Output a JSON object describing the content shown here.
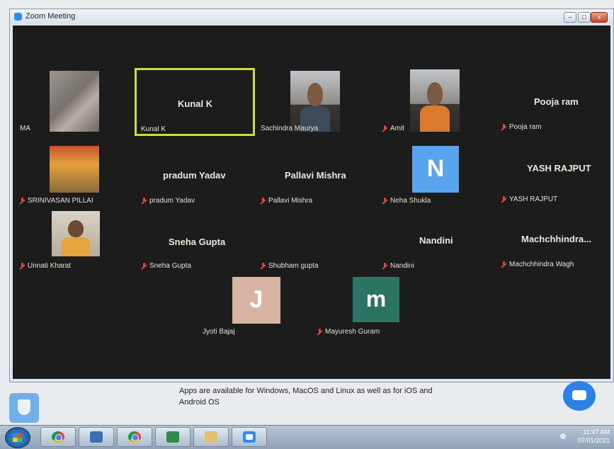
{
  "window": {
    "title": "Zoom Meeting",
    "buttons": {
      "minimize": "–",
      "maximize": "□",
      "close": "x"
    }
  },
  "participants": [
    {
      "name": "MA",
      "big_name": "",
      "muted": false,
      "kind": "video",
      "icon": "video-wall"
    },
    {
      "name": "Kunal K",
      "big_name": "Kunal K",
      "muted": false,
      "kind": "name",
      "active_speaker": true
    },
    {
      "name": "Sachindra Maurya",
      "big_name": "",
      "muted": false,
      "kind": "video",
      "icon": "video-person"
    },
    {
      "name": "Amit",
      "big_name": "",
      "muted": true,
      "kind": "video",
      "icon": "video-person"
    },
    {
      "name": "Pooja ram",
      "big_name": "Pooja ram",
      "muted": true,
      "kind": "name"
    },
    {
      "name": "SRINIVASAN PILLAI",
      "big_name": "",
      "muted": true,
      "kind": "video",
      "icon": "video-shrine"
    },
    {
      "name": "pradum Yadav",
      "big_name": "pradum Yadav",
      "muted": true,
      "kind": "name"
    },
    {
      "name": "Pallavi Mishra",
      "big_name": "Pallavi Mishra",
      "muted": true,
      "kind": "name"
    },
    {
      "name": "Neha Shukla",
      "big_name": "",
      "muted": true,
      "kind": "avatar",
      "initial": "N",
      "color": "#5aa3ef"
    },
    {
      "name": "YASH RAJPUT",
      "big_name": "YASH RAJPUT",
      "muted": true,
      "kind": "name"
    },
    {
      "name": "Unnati Kharat",
      "big_name": "",
      "muted": true,
      "kind": "video",
      "icon": "video-person"
    },
    {
      "name": "Sneha Gupta",
      "big_name": "Sneha Gupta",
      "muted": true,
      "kind": "name"
    },
    {
      "name": "Shubham gupta",
      "big_name": "",
      "muted": true,
      "kind": "name"
    },
    {
      "name": "Nandini",
      "big_name": "Nandini",
      "muted": true,
      "kind": "name"
    },
    {
      "name": "Machchhindra Wagh",
      "big_name": "Machchhindra...",
      "muted": true,
      "kind": "name"
    },
    {
      "name": "Jyoti Bajaj",
      "big_name": "",
      "muted": false,
      "kind": "avatar",
      "initial": "J",
      "color": "#d8b4a3"
    },
    {
      "name": "Mayuresh Guram",
      "big_name": "",
      "muted": true,
      "kind": "avatar",
      "initial": "m",
      "color": "#2b7461"
    }
  ],
  "page": {
    "info_text": "Apps are available for Windows, MacOS and Linux as well as for iOS and Android OS",
    "shield_icon": "shield-icon",
    "chat_icon": "chat-bubble-icon"
  },
  "taskbar": {
    "apps": [
      "chrome",
      "documents",
      "chrome",
      "excel",
      "folder",
      "zoom"
    ],
    "clock_time": "11:47 AM",
    "clock_date": "07/01/2021"
  }
}
